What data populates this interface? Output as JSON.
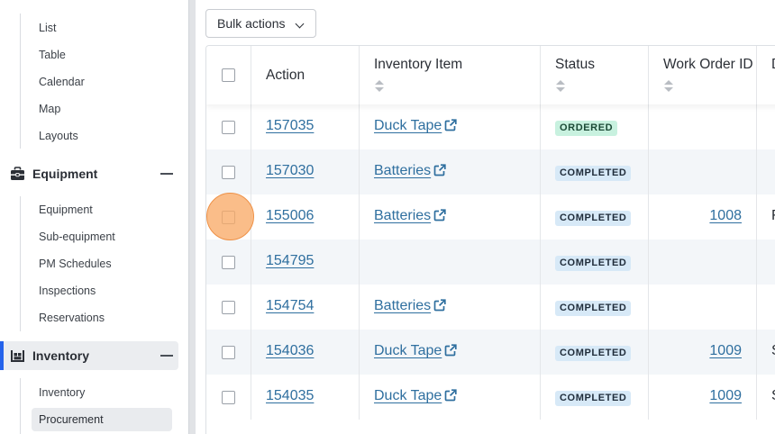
{
  "sidebar": {
    "views_items": [
      {
        "label": "List"
      },
      {
        "label": "Table"
      },
      {
        "label": "Calendar"
      },
      {
        "label": "Map"
      },
      {
        "label": "Layouts"
      }
    ],
    "equipment_section": {
      "label": "Equipment",
      "items": [
        {
          "label": "Equipment"
        },
        {
          "label": "Sub-equipment"
        },
        {
          "label": "PM Schedules"
        },
        {
          "label": "Inspections"
        },
        {
          "label": "Reservations"
        }
      ]
    },
    "inventory_section": {
      "label": "Inventory",
      "items": [
        {
          "label": "Inventory"
        },
        {
          "label": "Procurement"
        }
      ]
    }
  },
  "toolbar": {
    "bulk_actions_label": "Bulk actions"
  },
  "table": {
    "columns": {
      "action": "Action",
      "inventory_item": "Inventory Item",
      "status": "Status",
      "work_order_id": "Work Order ID",
      "description": "D"
    },
    "rows": [
      {
        "action": "157035",
        "item": "Duck Tape",
        "status": "ORDERED",
        "status_kind": "ordered",
        "work_order": "",
        "desc": ""
      },
      {
        "action": "157030",
        "item": "Batteries",
        "status": "COMPLETED",
        "status_kind": "completed",
        "work_order": "",
        "desc": ""
      },
      {
        "action": "155006",
        "item": "Batteries",
        "status": "COMPLETED",
        "status_kind": "completed",
        "work_order": "1008",
        "desc": "F"
      },
      {
        "action": "154795",
        "item": "",
        "status": "COMPLETED",
        "status_kind": "completed",
        "work_order": "",
        "desc": ""
      },
      {
        "action": "154754",
        "item": "Batteries",
        "status": "COMPLETED",
        "status_kind": "completed",
        "work_order": "",
        "desc": ""
      },
      {
        "action": "154036",
        "item": "Duck Tape",
        "status": "COMPLETED",
        "status_kind": "completed",
        "work_order": "1009",
        "desc": "S"
      },
      {
        "action": "154035",
        "item": "Duck Tape",
        "status": "COMPLETED",
        "status_kind": "completed",
        "work_order": "1009",
        "desc": "S"
      }
    ]
  },
  "icons": {
    "external_link": "external-link-icon",
    "equipment": "toolbox-icon",
    "inventory": "warehouse-icon",
    "collapse": "minus-icon",
    "sort": "sort-icon",
    "dropdown": "chevron-down-icon"
  },
  "colors": {
    "link": "#2f6f9f",
    "accent": "#2563eb",
    "completed_badge": "#d7e9f7",
    "ordered_badge": "#c8f1df",
    "click_marker": "#f8aa68"
  }
}
